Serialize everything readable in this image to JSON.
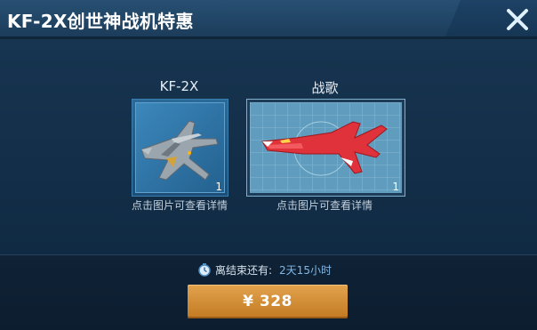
{
  "header": {
    "title": "KF-2X创世神战机特惠"
  },
  "cards": [
    {
      "name": "KF-2X",
      "quantity": "1",
      "hint": "点击图片可查看详情",
      "image": "gray-stealth-fighter-jet"
    },
    {
      "name": "战歌",
      "quantity": "1",
      "hint": "点击图片可查看详情",
      "image": "red-fighter-jet-on-blueprint"
    }
  ],
  "timer": {
    "label": "离结束还有:",
    "value": "2天15小时"
  },
  "buy_button": {
    "label": "¥ 328"
  },
  "colors": {
    "accent_gold": "#d48f38",
    "timer_blue": "#7fb8e8",
    "header_blue": "#275073"
  }
}
